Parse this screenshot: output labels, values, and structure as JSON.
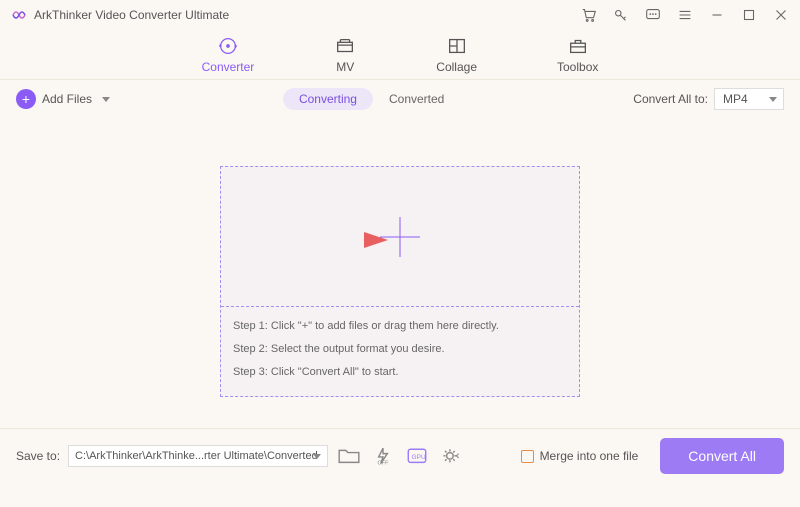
{
  "app": {
    "title": "ArkThinker Video Converter Ultimate"
  },
  "tabs": {
    "converter": "Converter",
    "mv": "MV",
    "collage": "Collage",
    "toolbox": "Toolbox"
  },
  "toolbar": {
    "add_files": "Add Files",
    "converting": "Converting",
    "converted": "Converted",
    "convert_all_to": "Convert All to:",
    "format": "MP4"
  },
  "dropzone": {
    "step1": "Step 1: Click \"+\" to add files or drag them here directly.",
    "step2": "Step 2: Select the output format you desire.",
    "step3": "Step 3: Click \"Convert All\" to start."
  },
  "bottom": {
    "save_to": "Save to:",
    "path": "C:\\ArkThinker\\ArkThinke...rter Ultimate\\Converted",
    "merge": "Merge into one file",
    "convert_all": "Convert All"
  }
}
